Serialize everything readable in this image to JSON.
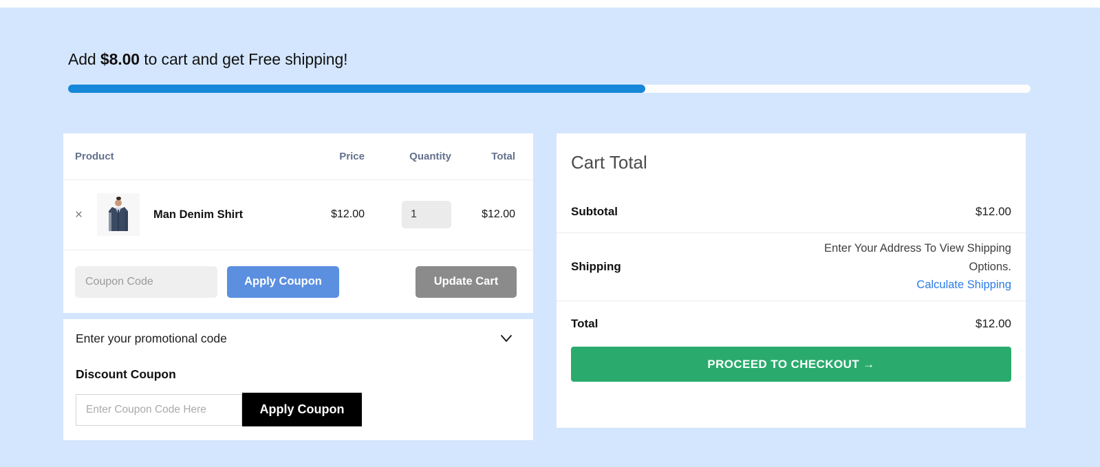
{
  "free_shipping": {
    "prefix": "Add ",
    "amount": "$8.00",
    "suffix": " to cart and get Free shipping!",
    "progress_percent": 60,
    "bar_color": "#1687d9"
  },
  "page": {
    "background_color": "#d4e6fd"
  },
  "cart_table": {
    "headers": {
      "product": "Product",
      "price": "Price",
      "quantity": "Quantity",
      "total": "Total"
    },
    "rows": [
      {
        "remove_label": "×",
        "name": "Man Denim Shirt",
        "price": "$12.00",
        "quantity": "1",
        "total": "$12.00"
      }
    ]
  },
  "coupon_row": {
    "input_placeholder": "Coupon Code",
    "input_value": "",
    "apply_label": "Apply Coupon",
    "apply_color": "#5b8fe0",
    "update_label": "Update Cart",
    "update_color": "#8b8b8b"
  },
  "promo": {
    "header": "Enter your promotional code",
    "subtitle": "Discount Coupon",
    "input_placeholder": "Enter Coupon Code Here",
    "input_value": "",
    "apply_label": "Apply Coupon"
  },
  "totals": {
    "title": "Cart Total",
    "subtotal_label": "Subtotal",
    "subtotal_value": "$12.00",
    "shipping_label": "Shipping",
    "shipping_note": "Enter Your Address To View Shipping Options.",
    "shipping_link": "Calculate Shipping",
    "shipping_link_color": "#2a7be4",
    "total_label": "Total",
    "total_value": "$12.00",
    "checkout_label": "PROCEED TO CHECKOUT →",
    "checkout_color": "#2aab6d"
  }
}
